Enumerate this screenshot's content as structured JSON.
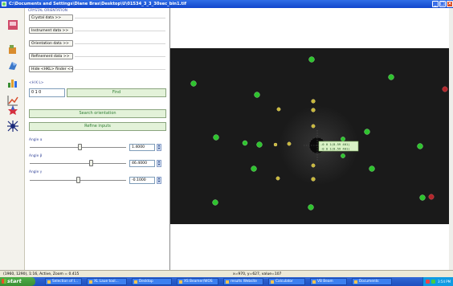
{
  "window": {
    "title": "C:\\Documents and Settings\\Diane Bras\\Desktop\\U\\01534_3_3_30sec_bin1.tif"
  },
  "left_toolbar": {
    "icons": [
      "image-icon",
      "flask-icon",
      "crystal-icon",
      "bar-chart-icon",
      "line-graph-icon",
      "star-icon",
      "spider-icon"
    ]
  },
  "panel": {
    "group_title": "CRYSTAL ORIENTATION",
    "buttons": {
      "crystal": "Crystal data >>",
      "instrument": "Instrument data >>",
      "orientation": "Orientation data >>",
      "refinement": "Refinement data >>",
      "hide_finder": "Hide <HKL> finder <<"
    },
    "hkl_label": "<H K L>",
    "hkl_value": "0 1 0",
    "find_button": "Find",
    "search_button": "Search orientation",
    "refine_button": "Refine inputs",
    "angles": [
      {
        "label": "Angle α",
        "value": "1.4000",
        "level": 0.52
      },
      {
        "label": "Angle β",
        "value": "46.4000",
        "level": 0.64
      },
      {
        "label": "Angle γ",
        "value": "-0.1000",
        "level": 0.5
      }
    ]
  },
  "image_view": {
    "annotation_lines": [
      "-0  0  1(8.59  401)",
      "-0  0  1(8.59  401)"
    ],
    "colors": {
      "spot_green": "#2ec42e",
      "spot_yellow": "#c8b83a",
      "spot_red": "#b3262b",
      "label_bg": "#d9f2c6"
    }
  },
  "status": {
    "left": "(1960, 1290), 1:16, Active, Zoom = 0.415",
    "middle": "x=970, y=627, value=107"
  },
  "taskbar": {
    "start": "start",
    "items": [
      "Selection of I...",
      "XL Laue tool...",
      "Desktop",
      "XS Beamer/WOS",
      "results Website",
      "Calculator",
      "VB Beam",
      "Documents"
    ],
    "clock": "3:54 PM"
  }
}
